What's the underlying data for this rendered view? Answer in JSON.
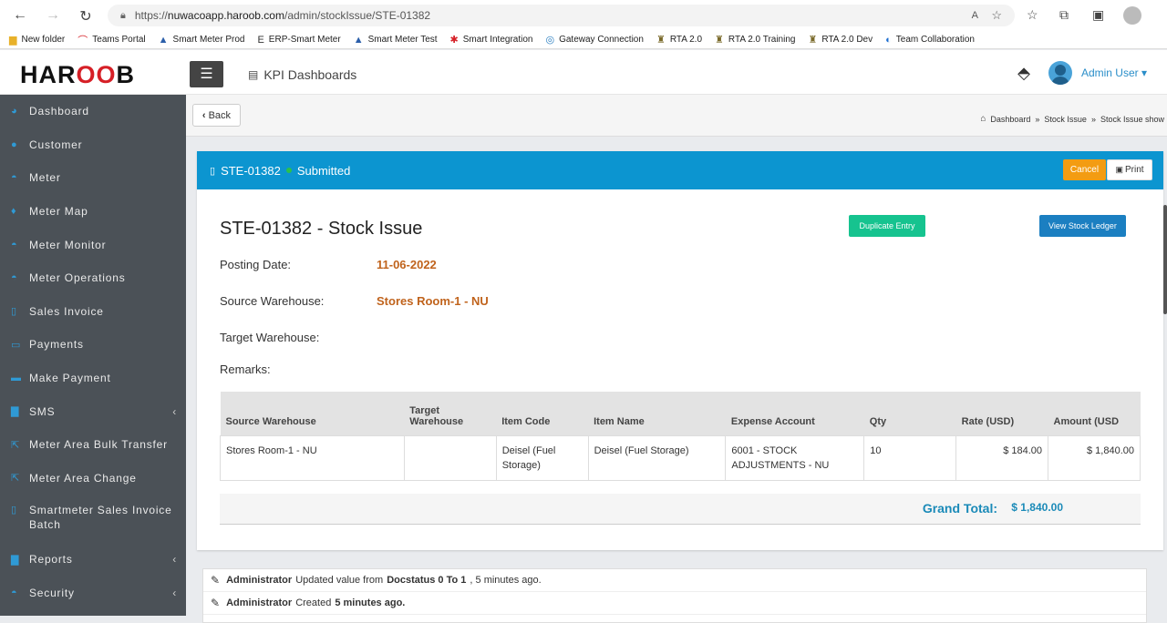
{
  "browser": {
    "url_prefix": "https://",
    "url_host": "nuwacoapp.haroob.com",
    "url_path": "/admin/stockIssue/STE-01382"
  },
  "bookmarks": [
    {
      "icon": "folder-icon",
      "glyph": "▆",
      "color": "#e8b12a",
      "label": "New folder"
    },
    {
      "icon": "teams-icon",
      "glyph": "⌒",
      "color": "#d61f26",
      "label": "Teams Portal"
    },
    {
      "icon": "drop-icon",
      "glyph": "▲",
      "color": "#2b5faa",
      "label": "Smart Meter Prod"
    },
    {
      "icon": "erp-icon",
      "glyph": "E",
      "color": "#333333",
      "label": "ERP-Smart Meter"
    },
    {
      "icon": "drop-icon",
      "glyph": "▲",
      "color": "#2b5faa",
      "label": "Smart Meter Test"
    },
    {
      "icon": "integration-icon",
      "glyph": "✱",
      "color": "#d61f26",
      "label": "Smart Integration"
    },
    {
      "icon": "gateway-icon",
      "glyph": "◎",
      "color": "#2b7fc1",
      "label": "Gateway Connection"
    },
    {
      "icon": "rta-icon",
      "glyph": "♜",
      "color": "#7a6a2a",
      "label": "RTA 2.0"
    },
    {
      "icon": "rta-icon",
      "glyph": "♜",
      "color": "#7a6a2a",
      "label": "RTA 2.0 Training"
    },
    {
      "icon": "rta-icon",
      "glyph": "♜",
      "color": "#7a6a2a",
      "label": "RTA 2.0 Dev"
    },
    {
      "icon": "collab-icon",
      "glyph": "◐",
      "color": "#1f6fd1",
      "label": "Team Collaboration"
    }
  ],
  "header": {
    "logo_left": "HAR",
    "logo_mid": "OO",
    "logo_right": "B",
    "kpi_label": "KPI Dashboards",
    "user_label": "Admin User ▾"
  },
  "sidebar": [
    {
      "label": "Dashboard",
      "icon": "dashboard-icon",
      "glyph": "◕",
      "chevron": false
    },
    {
      "label": "Customer",
      "icon": "user-icon",
      "glyph": "●",
      "chevron": false
    },
    {
      "label": "Meter",
      "icon": "meter-icon",
      "glyph": "◓",
      "chevron": false
    },
    {
      "label": "Meter Map",
      "icon": "map-marker-icon",
      "glyph": "♦",
      "chevron": false
    },
    {
      "label": "Meter Monitor",
      "icon": "monitor-icon",
      "glyph": "◓",
      "chevron": false
    },
    {
      "label": "Meter Operations",
      "icon": "operations-icon",
      "glyph": "◓",
      "chevron": false
    },
    {
      "label": "Sales Invoice",
      "icon": "file-icon",
      "glyph": "▯",
      "chevron": false
    },
    {
      "label": "Payments",
      "icon": "money-icon",
      "glyph": "▭",
      "chevron": false
    },
    {
      "label": "Make Payment",
      "icon": "card-icon",
      "glyph": "▬",
      "chevron": false
    },
    {
      "label": "SMS",
      "icon": "sms-icon",
      "glyph": "▇",
      "chevron": true
    },
    {
      "label": "Meter Area Bulk Transfer",
      "icon": "transfer-icon",
      "glyph": "⇱",
      "chevron": false
    },
    {
      "label": "Meter Area Change",
      "icon": "change-icon",
      "glyph": "⇱",
      "chevron": false
    },
    {
      "label": "Smartmeter Sales Invoice Batch",
      "icon": "file-icon",
      "glyph": "▯",
      "chevron": false,
      "two_line": true
    },
    {
      "label": "Reports",
      "icon": "reports-icon",
      "glyph": "▇",
      "chevron": true
    },
    {
      "label": "Security",
      "icon": "security-icon",
      "glyph": "◓",
      "chevron": true
    }
  ],
  "subbar": {
    "back_label": "Back",
    "crumb_1": "Dashboard",
    "crumb_2": "Stock Issue",
    "crumb_3": "Stock Issue show"
  },
  "panel": {
    "doc_id": "STE-01382",
    "status": "Submitted",
    "cancel_label": "Cancel",
    "print_label": "Print",
    "title": "STE-01382 - Stock Issue",
    "duplicate_label": "Duplicate Entry",
    "ledger_label": "View Stock Ledger",
    "posting_date_label": "Posting Date:",
    "posting_date": "11-06-2022",
    "source_wh_label": "Source Warehouse:",
    "source_wh": "Stores Room-1 - NU",
    "target_wh_label": "Target Warehouse:",
    "remarks_label": "Remarks:"
  },
  "table": {
    "headers": [
      "Source Warehouse",
      "Target Warehouse",
      "Item Code",
      "Item Name",
      "Expense Account",
      "Qty",
      "Rate (USD)",
      "Amount (USD"
    ],
    "rows": [
      [
        "Stores Room-1 - NU",
        "",
        "Deisel (Fuel Storage)",
        "Deisel (Fuel Storage)",
        "6001 - STOCK ADJUSTMENTS - NU",
        "10",
        "$ 184.00",
        "$ 1,840.00"
      ]
    ]
  },
  "totals": {
    "label": "Grand Total:",
    "value": "$ 1,840.00"
  },
  "activity": [
    {
      "user": "Administrator",
      "text_a": "Updated value from",
      "bold_a": "Docstatus 0 To 1",
      "text_b": ", 5 minutes ago."
    },
    {
      "user": "Administrator",
      "text_a": "Created",
      "bold_a": "5 minutes ago.",
      "text_b": ""
    }
  ]
}
